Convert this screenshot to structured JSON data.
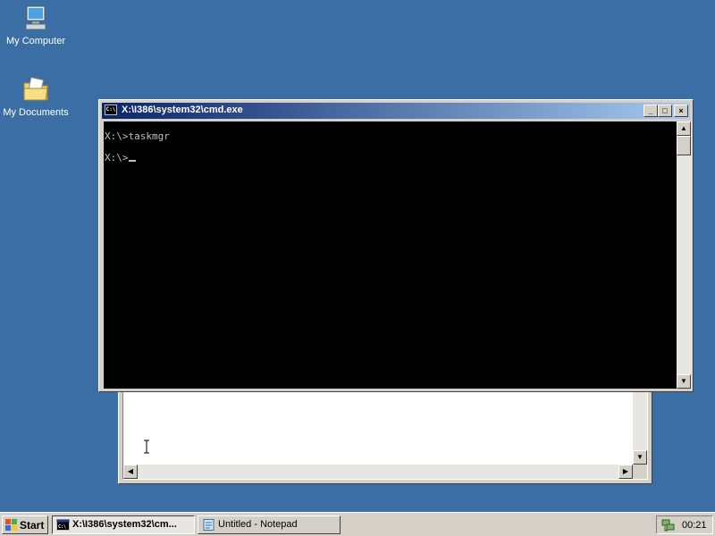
{
  "desktop": {
    "icons": [
      {
        "label": "My Computer"
      },
      {
        "label": "My Documents"
      }
    ]
  },
  "cmd_window": {
    "title": "X:\\I386\\system32\\cmd.exe",
    "icon_text": "C:\\",
    "buttons": {
      "minimize": "_",
      "maximize": "□",
      "close": "×"
    },
    "lines": [
      "X:\\>taskmgr",
      "X:\\>"
    ]
  },
  "notepad_window": {
    "title": "Untitled - Notepad",
    "content": ""
  },
  "taskbar": {
    "start_label": "Start",
    "tasks": [
      {
        "label": "X:\\I386\\system32\\cm...",
        "active": true
      },
      {
        "label": "Untitled - Notepad",
        "active": false
      }
    ],
    "clock": "00:21"
  },
  "colors": {
    "desktop": "#3a6ea5",
    "titlebar_start": "#0a246a",
    "titlebar_end": "#a6caf0",
    "console_bg": "#000000",
    "console_fg": "#c0c0c0",
    "chrome": "#d4d0c8"
  }
}
